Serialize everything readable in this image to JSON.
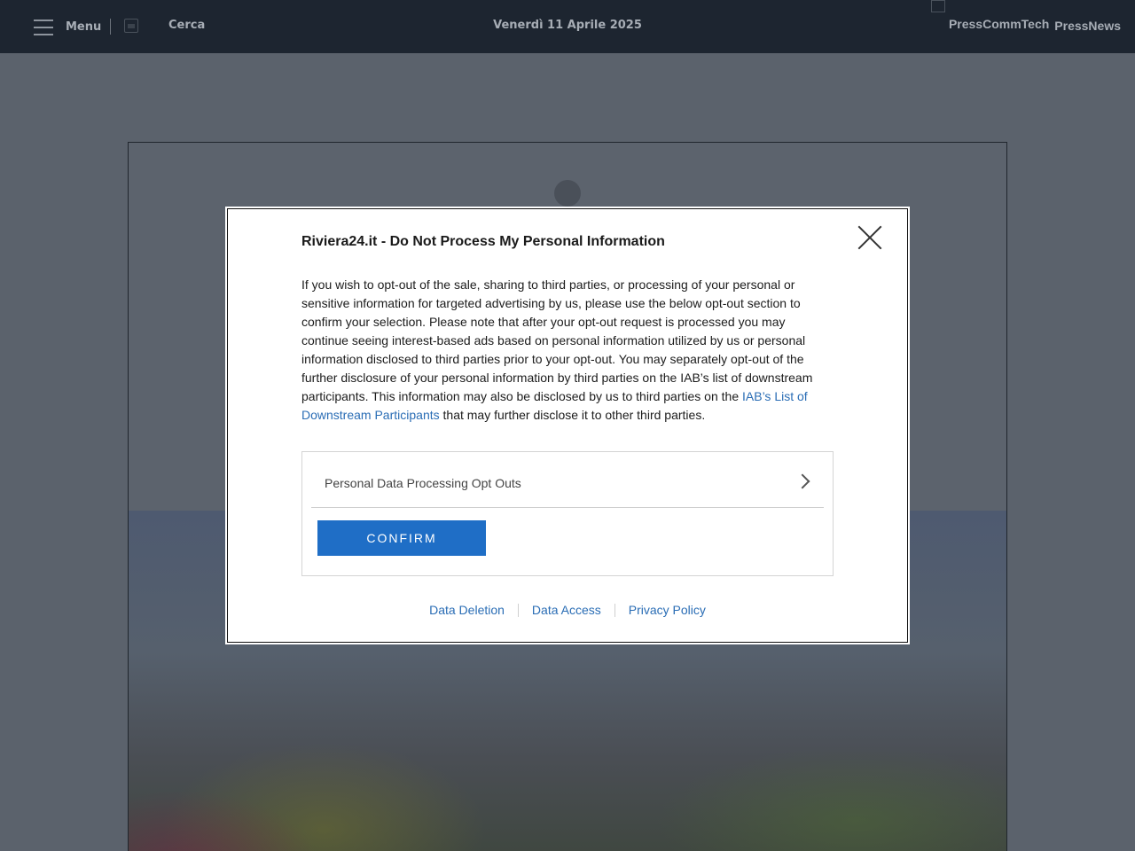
{
  "header": {
    "menu_label": "Menu",
    "search_label": "Cerca",
    "date": "Venerdì 11 Aprile 2025",
    "brands": [
      "PressCommTech",
      "PressNews"
    ]
  },
  "modal": {
    "title": "Riviera24.it - Do Not Process My Personal Information",
    "body_text": "If you wish to opt-out of the sale, sharing to third parties, or processing of your personal or sensitive information for targeted advertising by us, please use the below opt-out section to confirm your selection. Please note that after your opt-out request is processed you may continue seeing interest-based ads based on personal information utilized by us or personal information disclosed to third parties prior to your opt-out. You may separately opt-out of the further disclosure of your personal information by third parties on the IAB’s list of downstream participants. This information may also be disclosed by us to third parties on the ",
    "body_link": "IAB’s List of Downstream Participants",
    "body_tail": " that may further disclose it to other third parties.",
    "optout_label": "Personal Data Processing Opt Outs",
    "confirm_label": "CONFIRM",
    "footer_links": {
      "deletion": "Data Deletion",
      "access": "Data Access",
      "privacy": "Privacy Policy"
    }
  },
  "colors": {
    "topbar": "#1d2530",
    "overlay": "#5b626c",
    "accent": "#1f6ec6",
    "link": "#2a6db5"
  }
}
